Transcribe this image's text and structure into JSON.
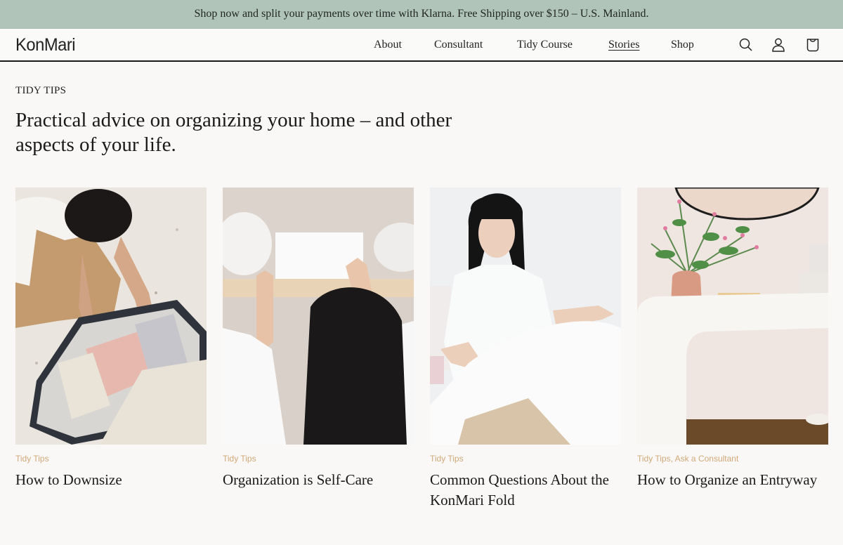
{
  "promo_bar": {
    "text": "Shop now and split your payments over time with Klarna. Free Shipping over $150 – U.S. Mainland."
  },
  "header": {
    "logo": "KonMari",
    "nav": [
      {
        "label": "About",
        "active": false
      },
      {
        "label": "Consultant",
        "active": false
      },
      {
        "label": "Tidy Course",
        "active": false
      },
      {
        "label": "Stories",
        "active": true
      },
      {
        "label": "Shop",
        "active": false
      }
    ],
    "icons": [
      "search-icon",
      "account-icon",
      "cart-icon"
    ]
  },
  "page": {
    "eyebrow": "TIDY TIPS",
    "headline": "Practical advice on organizing your home – and other aspects of your life."
  },
  "colors": {
    "promo_bg": "#b0c4ba",
    "tag": "#d0a978",
    "background": "#f9f8f6",
    "text": "#1a1a1a"
  },
  "articles": [
    {
      "tags": [
        "Tidy Tips"
      ],
      "title": "How to Downsize",
      "image": "woman-packing-suitcase"
    },
    {
      "tags": [
        "Tidy Tips"
      ],
      "title": "Organization is Self-Care",
      "image": "woman-placing-box-on-shelf"
    },
    {
      "tags": [
        "Tidy Tips"
      ],
      "title": "Common Questions About the KonMari Fold",
      "image": "woman-folding-white-sheet"
    },
    {
      "tags": [
        "Tidy Tips",
        "Ask a Consultant"
      ],
      "title": "How to Organize an Entryway",
      "image": "entryway-console-with-flowers"
    }
  ]
}
